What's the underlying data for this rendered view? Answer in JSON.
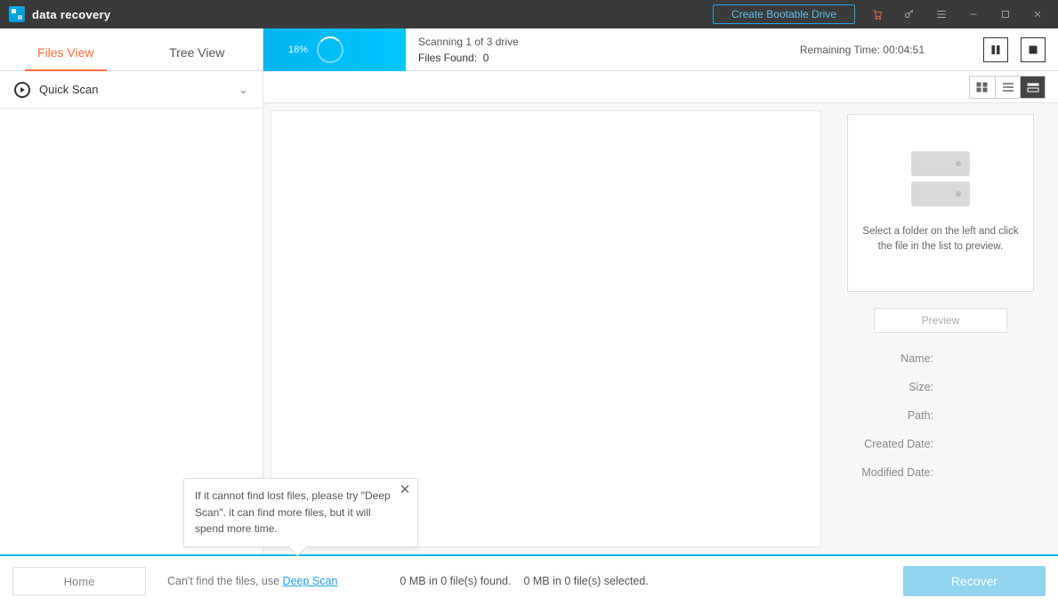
{
  "titlebar": {
    "app_name": "data recovery",
    "bootable": "Create Bootable Drive"
  },
  "sidebar": {
    "tabs": {
      "files": "Files View",
      "tree": "Tree View"
    },
    "quickscan": "Quick Scan"
  },
  "scan": {
    "percent": "18%",
    "line1": "Scanning 1 of 3 drive",
    "line2_label": "Files Found:",
    "line2_value": "0",
    "remaining_label": "Remaining Time:",
    "remaining_value": "00:04:51"
  },
  "preview": {
    "message": "Select a folder on the left and click the file in the list to preview.",
    "button": "Preview",
    "meta": {
      "name": "Name:",
      "size": "Size:",
      "path": "Path:",
      "created": "Created Date:",
      "modified": "Modified Date:"
    }
  },
  "footer": {
    "home": "Home",
    "hint_pre": "Can't find the files, use ",
    "hint_link": "Deep Scan",
    "found": "0 MB in 0 file(s) found.",
    "selected": "0 MB in 0 file(s) selected.",
    "recover": "Recover"
  },
  "tooltip": {
    "text": "If it cannot find lost files, please try \"Deep Scan\". it can find more files, but it will spend more time."
  }
}
